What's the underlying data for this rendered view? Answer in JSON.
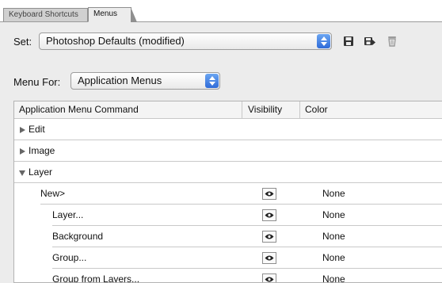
{
  "tabs": [
    {
      "label": "Keyboard Shortcuts",
      "active": false
    },
    {
      "label": "Menus",
      "active": true
    }
  ],
  "set": {
    "label": "Set:",
    "value": "Photoshop Defaults (modified)",
    "icons": [
      "save-set-icon",
      "save-set-as-icon",
      "delete-set-icon"
    ]
  },
  "menu_for": {
    "label": "Menu For:",
    "value": "Application Menus"
  },
  "table": {
    "headers": {
      "command": "Application Menu Command",
      "visibility": "Visibility",
      "color": "Color"
    },
    "rows": [
      {
        "name": "Edit",
        "level": 0,
        "expanded": false,
        "color": ""
      },
      {
        "name": "Image",
        "level": 0,
        "expanded": false,
        "color": ""
      },
      {
        "name": "Layer",
        "level": 0,
        "expanded": true,
        "color": ""
      },
      {
        "name": "New>",
        "level": 1,
        "visible": true,
        "color": "None"
      },
      {
        "name": "Layer...",
        "level": 2,
        "visible": true,
        "color": "None"
      },
      {
        "name": "Background",
        "level": 2,
        "visible": true,
        "color": "None"
      },
      {
        "name": "Group...",
        "level": 2,
        "visible": true,
        "color": "None"
      },
      {
        "name": "Group from Layers...",
        "level": 2,
        "visible": true,
        "color": "None"
      }
    ]
  }
}
